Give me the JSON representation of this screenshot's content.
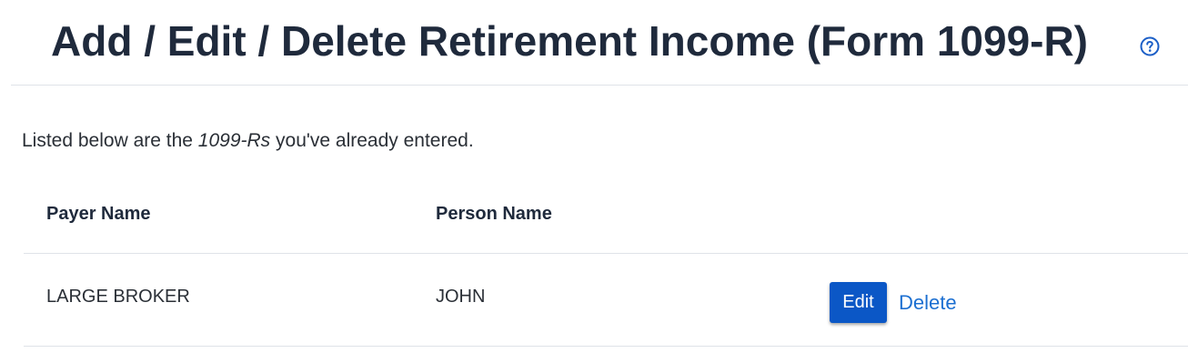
{
  "header": {
    "title": "Add / Edit / Delete Retirement Income (Form 1099-R)",
    "help_icon": "question-circle-icon"
  },
  "intro": {
    "prefix": "Listed below are the ",
    "emphasis": "1099-Rs",
    "suffix": " you've already entered."
  },
  "table": {
    "columns": [
      "Payer Name",
      "Person Name"
    ],
    "rows": [
      {
        "payer": "LARGE BROKER",
        "person": "JOHN",
        "edit_label": "Edit",
        "delete_label": "Delete"
      }
    ]
  },
  "colors": {
    "primary_button": "#0b57c6",
    "link": "#1c6fd1",
    "text": "#1f2a3c",
    "divider": "#dfe3e8"
  }
}
